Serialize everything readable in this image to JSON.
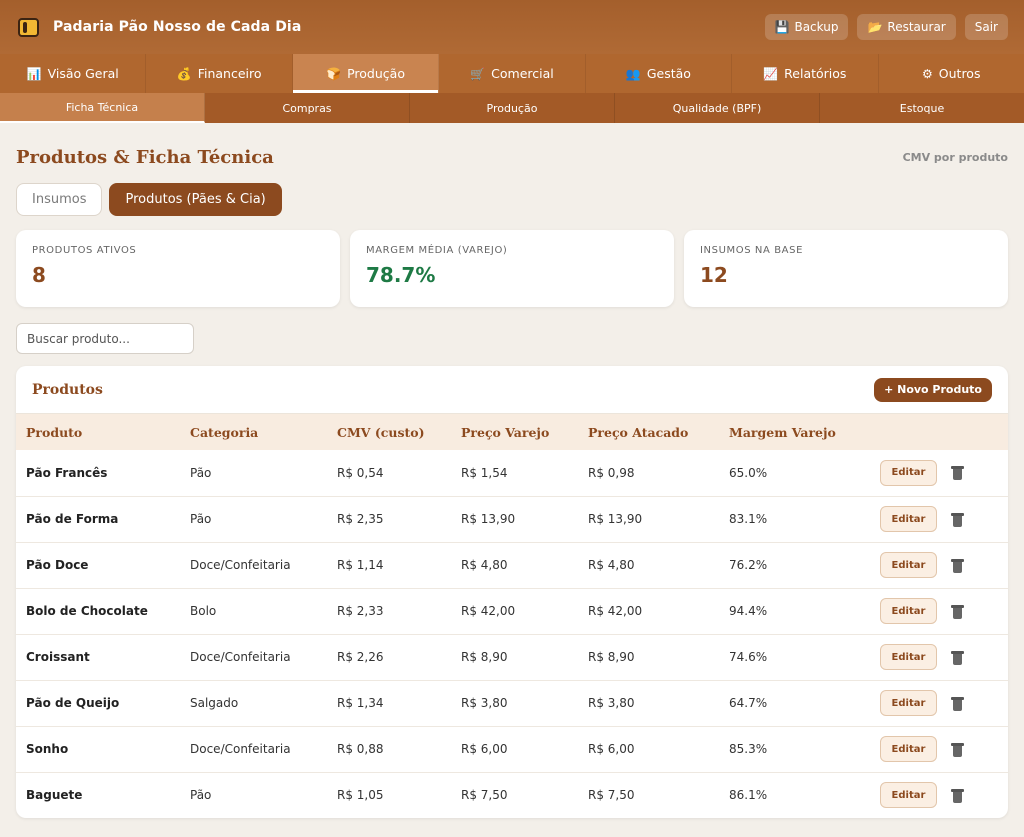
{
  "header": {
    "title": "Padaria Pão Nosso de Cada Dia",
    "logo_icon": "bread-icon",
    "actions": [
      {
        "label": "Backup",
        "icon": "floppy-disk-icon",
        "glyph": "💾"
      },
      {
        "label": "Restaurar",
        "icon": "folder-icon",
        "glyph": "📂"
      },
      {
        "label": "Sair",
        "icon": "",
        "glyph": ""
      }
    ]
  },
  "main_nav": [
    {
      "label": "Visão Geral",
      "glyph": "📊",
      "icon": "chart-icon",
      "active": false
    },
    {
      "label": "Financeiro",
      "glyph": "💰",
      "icon": "money-bag-icon",
      "active": false
    },
    {
      "label": "Produção",
      "glyph": "🍞",
      "icon": "bread-icon",
      "active": true
    },
    {
      "label": "Comercial",
      "glyph": "🛒",
      "icon": "cart-icon",
      "active": false
    },
    {
      "label": "Gestão",
      "glyph": "👥",
      "icon": "people-icon",
      "active": false
    },
    {
      "label": "Relatórios",
      "glyph": "📈",
      "icon": "trend-chart-icon",
      "active": false
    },
    {
      "label": "Outros",
      "glyph": "⚙",
      "icon": "gear-icon",
      "active": false
    }
  ],
  "sub_nav": [
    {
      "label": "Ficha Técnica",
      "active": true
    },
    {
      "label": "Compras",
      "active": false
    },
    {
      "label": "Produção",
      "active": false
    },
    {
      "label": "Qualidade (BPF)",
      "active": false
    },
    {
      "label": "Estoque",
      "active": false
    }
  ],
  "page": {
    "title": "Produtos & Ficha Técnica",
    "meta": "CMV por produto"
  },
  "segments": {
    "insumos": "Insumos",
    "produtos": "Produtos (Pães & Cia)"
  },
  "stats": [
    {
      "label": "Produtos Ativos",
      "value": "8",
      "color": "#8c4a1f"
    },
    {
      "label": "Margem Média (Varejo)",
      "value": "78.7%",
      "color": "#1e7a45"
    },
    {
      "label": "Insumos na Base",
      "value": "12",
      "color": "#8c4a1f"
    }
  ],
  "search": {
    "placeholder": "Buscar produto...",
    "value": ""
  },
  "panel": {
    "title": "Produtos",
    "new_button": "+ Novo Produto"
  },
  "table": {
    "columns": [
      "Produto",
      "Categoria",
      "CMV (custo)",
      "Preço Varejo",
      "Preço Atacado",
      "Margem Varejo"
    ],
    "edit_label": "Editar",
    "rows": [
      {
        "produto": "Pão Francês",
        "categoria": "Pão",
        "cmv": "R$ 0,54",
        "varejo": "R$ 1,54",
        "atacado": "R$ 0,98",
        "margem": "65.0%"
      },
      {
        "produto": "Pão de Forma",
        "categoria": "Pão",
        "cmv": "R$ 2,35",
        "varejo": "R$ 13,90",
        "atacado": "R$ 13,90",
        "margem": "83.1%"
      },
      {
        "produto": "Pão Doce",
        "categoria": "Doce/Confeitaria",
        "cmv": "R$ 1,14",
        "varejo": "R$ 4,80",
        "atacado": "R$ 4,80",
        "margem": "76.2%"
      },
      {
        "produto": "Bolo de Chocolate",
        "categoria": "Bolo",
        "cmv": "R$ 2,33",
        "varejo": "R$ 42,00",
        "atacado": "R$ 42,00",
        "margem": "94.4%"
      },
      {
        "produto": "Croissant",
        "categoria": "Doce/Confeitaria",
        "cmv": "R$ 2,26",
        "varejo": "R$ 8,90",
        "atacado": "R$ 8,90",
        "margem": "74.6%"
      },
      {
        "produto": "Pão de Queijo",
        "categoria": "Salgado",
        "cmv": "R$ 1,34",
        "varejo": "R$ 3,80",
        "atacado": "R$ 3,80",
        "margem": "64.7%"
      },
      {
        "produto": "Sonho",
        "categoria": "Doce/Confeitaria",
        "cmv": "R$ 0,88",
        "varejo": "R$ 6,00",
        "atacado": "R$ 6,00",
        "margem": "85.3%"
      },
      {
        "produto": "Baguete",
        "categoria": "Pão",
        "cmv": "R$ 1,05",
        "varejo": "R$ 7,50",
        "atacado": "R$ 7,50",
        "margem": "86.1%"
      }
    ]
  }
}
